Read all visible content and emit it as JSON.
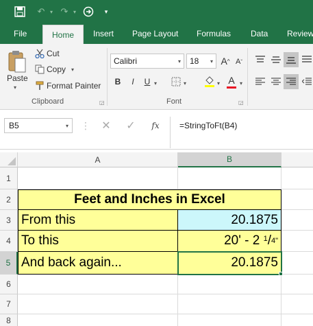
{
  "quick_access": {
    "save_icon": "save-icon",
    "undo_icon": "undo-icon",
    "redo_icon": "redo-icon",
    "go_icon": "circle-arrow-icon",
    "customize_icon": "chevron-down-icon"
  },
  "tabs": [
    "File",
    "Home",
    "Insert",
    "Page Layout",
    "Formulas",
    "Data",
    "Review"
  ],
  "active_tab": "Home",
  "ribbon": {
    "clipboard": {
      "paste_label": "Paste",
      "cut_label": "Cut",
      "copy_label": "Copy",
      "format_painter_label": "Format Painter",
      "group_label": "Clipboard"
    },
    "font": {
      "font_name": "Calibri",
      "font_size": "18",
      "grow_label": "A",
      "shrink_label": "A",
      "bold_label": "B",
      "italic_label": "I",
      "underline_label": "U",
      "font_color_label": "A",
      "group_label": "Font"
    }
  },
  "formula_bar": {
    "name_box": "B5",
    "fx_label": "fx",
    "formula": "=StringToFt(B4)"
  },
  "grid": {
    "columns": [
      "A",
      "B"
    ],
    "rows": [
      "1",
      "2",
      "3",
      "4",
      "5",
      "6",
      "7",
      "8"
    ],
    "cells": {
      "title": "Feet and Inches in Excel",
      "a3": "From this",
      "b3": "20.1875",
      "a4": "To this",
      "b4_main": "20' - 2 ",
      "b4_num": "1",
      "b4_den": "4\"",
      "a5": "And back again...",
      "b5": "20.1875"
    }
  },
  "colors": {
    "excel_green": "#217346",
    "highlight_yellow": "#ffff99",
    "highlight_cyan": "#ccf7fb"
  }
}
